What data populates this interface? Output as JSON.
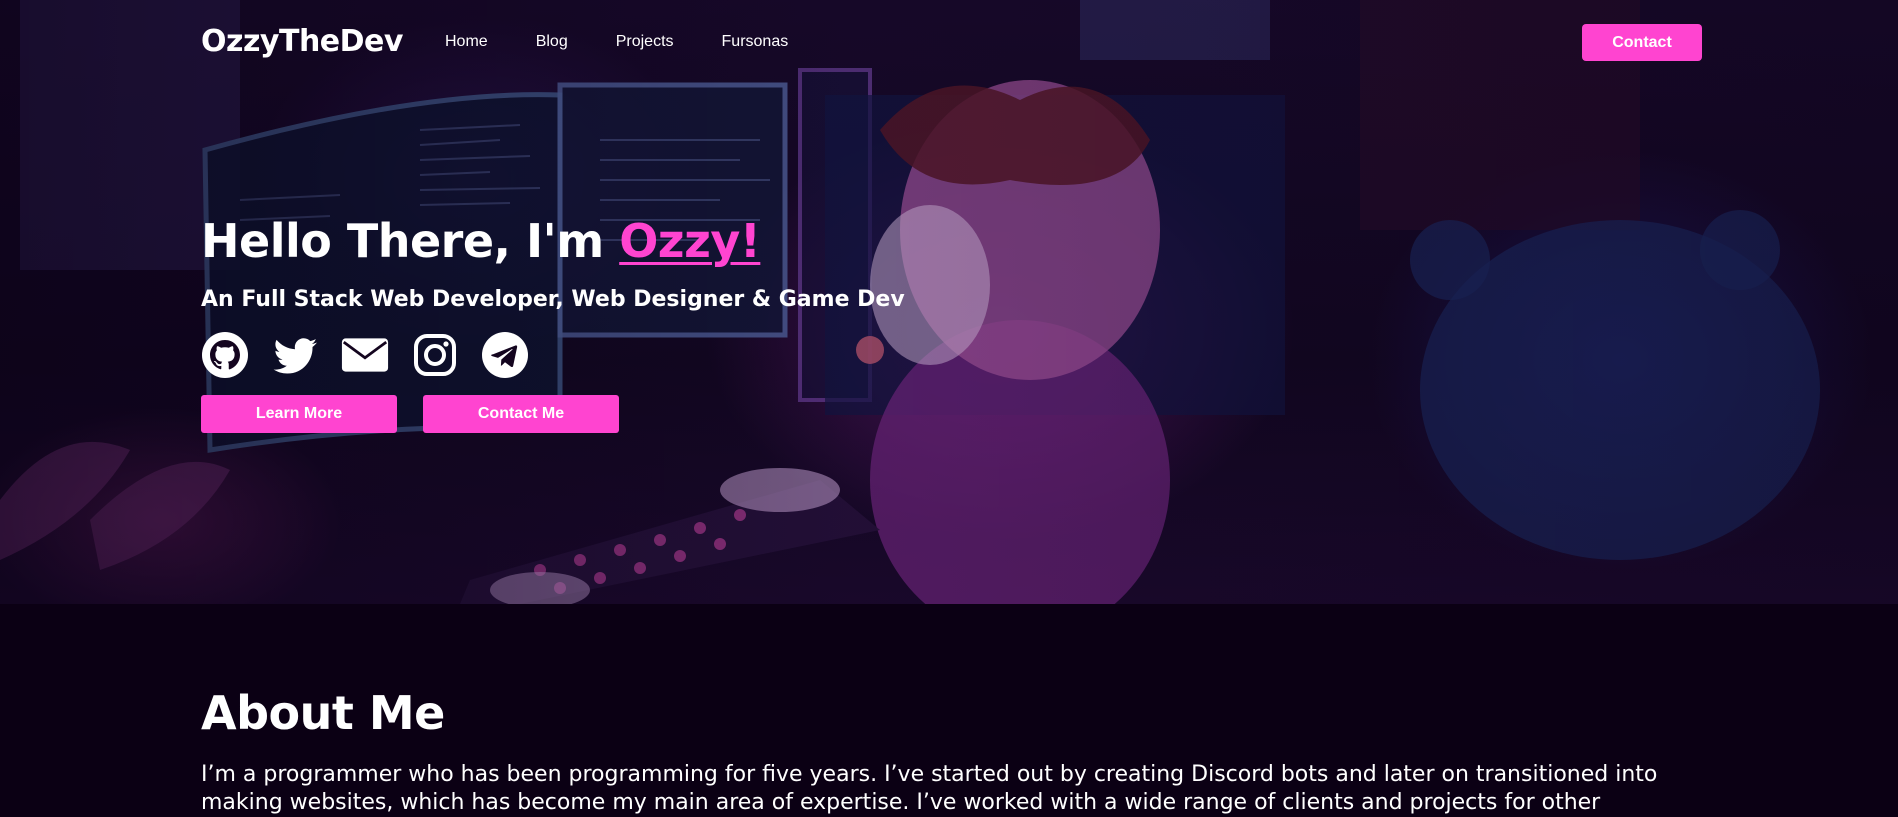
{
  "brand": {
    "logo_text": "OzzyTheDev",
    "accent_color": "#ff44d0"
  },
  "nav": {
    "links": [
      "Home",
      "Blog",
      "Projects",
      "Fursonas"
    ],
    "contact_label": "Contact"
  },
  "hero": {
    "title_prefix": "Hello There, I'm ",
    "title_name": "Ozzy!",
    "subtitle": "An Full Stack Web Developer, Web Designer & Game Dev",
    "socials": [
      "github-icon",
      "twitter-icon",
      "mail-icon",
      "instagram-icon",
      "telegram-icon"
    ],
    "learn_more_label": "Learn More",
    "contact_me_label": "Contact Me"
  },
  "about": {
    "title": "About Me",
    "text": "I’m a programmer who has been programming for five years. I’ve started out by creating Discord bots and later on transitioned into making websites, which has become my main area of expertise. I’ve worked with a wide range of clients and projects for other"
  }
}
